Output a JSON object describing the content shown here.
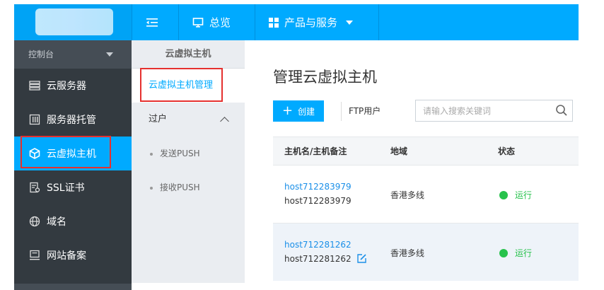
{
  "topbar": {
    "overview_label": "总览",
    "products_label": "产品与服务"
  },
  "sidebar": {
    "header": "控制台",
    "items": [
      {
        "label": "云服务器",
        "icon": "server-list-icon"
      },
      {
        "label": "服务器托管",
        "icon": "server-rack-icon"
      },
      {
        "label": "云虚拟主机",
        "icon": "cube-icon",
        "active": true
      },
      {
        "label": "SSL证书",
        "icon": "certificate-icon"
      },
      {
        "label": "域名",
        "icon": "globe-icon"
      },
      {
        "label": "网站备案",
        "icon": "monitor-icon"
      }
    ]
  },
  "subnav": {
    "title": "云虚拟主机",
    "active_item": "云虚拟主机管理",
    "group": "过户",
    "children": [
      "发送PUSH",
      "接收PUSH"
    ]
  },
  "main": {
    "title": "管理云虚拟主机",
    "create_label": "创建",
    "ftp_label": "FTP用户",
    "search_placeholder": "请输入搜索关键词",
    "columns": [
      "主机名/主机备注",
      "地域",
      "状态"
    ],
    "rows": [
      {
        "host": "host712283979",
        "note": "host712283979",
        "region": "香港多线",
        "status": "运行"
      },
      {
        "host": "host712281262",
        "note": "host712281262",
        "region": "香港多线",
        "status": "运行"
      }
    ]
  },
  "colors": {
    "accent": "#00aaff",
    "sidebar_bg": "#333a40",
    "status_running": "#27c24c",
    "highlight_box": "#e5312f"
  }
}
